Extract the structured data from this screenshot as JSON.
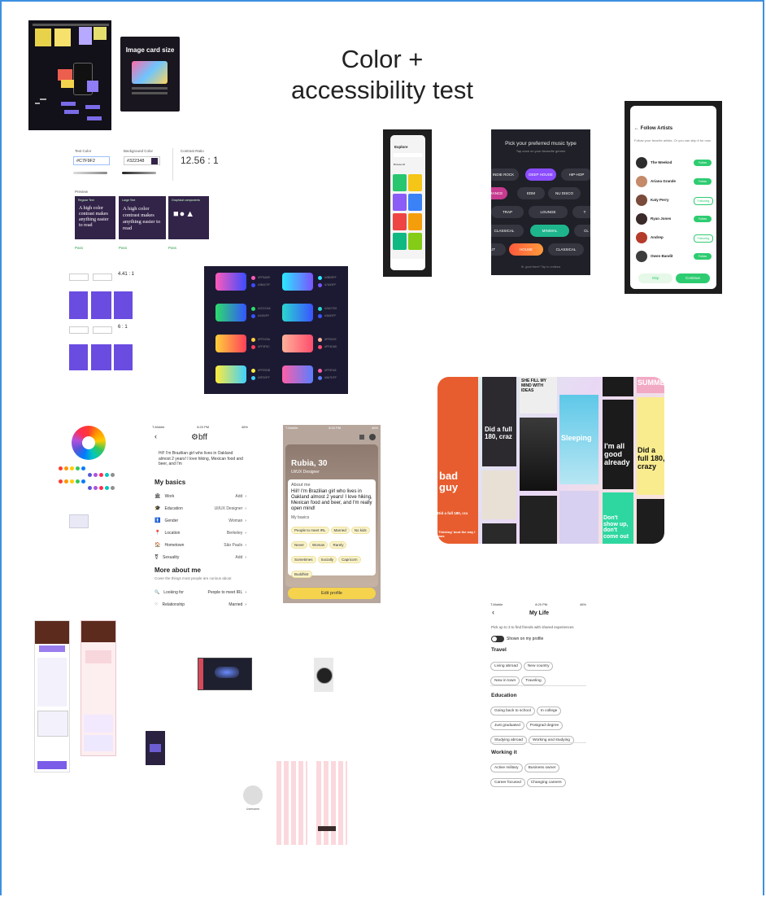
{
  "canvas": {
    "title_line1": "Color +",
    "title_line2": "accessibility test"
  },
  "image_card": {
    "title": "Image card size"
  },
  "contrast_test": {
    "text_color_label": "Text Color",
    "bg_color_label": "Background Color",
    "ratio_label": "Contrast Ratio",
    "text_color": "#C7F9F2",
    "bg_color": "#322348",
    "ratio": "12.56 : 1",
    "preview_label": "Preview",
    "normal_text_label": "Regular Text",
    "large_text_label": "Large Text",
    "graphical_label": "Graphical components",
    "sample": "A high color contrast makes anything easier to read",
    "pass": "Pass"
  },
  "mini_contrast": {
    "ratio1": "4.41 : 1",
    "ratio2": "6 : 1"
  },
  "gradients": {
    "rows": [
      {
        "c1": "#ff5ab9",
        "c2": "#3b4cff",
        "h1": "#FF5AB9",
        "h2": "#3B4CFF"
      },
      {
        "c1": "#2be8ff",
        "c2": "#7a53ff",
        "h1": "#2BE8FF",
        "h2": "#7A53FF"
      },
      {
        "c1": "#2cdc6a",
        "c2": "#3454ff",
        "h1": "#2CDC6A",
        "h2": "#3454FF"
      },
      {
        "c1": "#2ad7d0",
        "c2": "#3a52ff",
        "h1": "#2AD7D0",
        "h2": "#3A52FF"
      },
      {
        "c1": "#ffd03a",
        "c2": "#ff3f5c",
        "h1": "#FFD03A",
        "h2": "#FF3F5C"
      },
      {
        "c1": "#ffb199",
        "c2": "#ff4d6d",
        "h1": "#FFB199",
        "h2": "#FF4D6D"
      },
      {
        "c1": "#ffeb3b",
        "c2": "#3fd0ff",
        "h1": "#FFEB3B",
        "h2": "#3FD0FF"
      },
      {
        "c1": "#ff5fa8",
        "c2": "#5a7dff",
        "h1": "#FF5FA8",
        "h2": "#5A7DFF"
      }
    ]
  },
  "explore": {
    "title": "Explore",
    "browse": "Browse All"
  },
  "music_type": {
    "title": "Pick your preferred music type",
    "subtitle": "Tap once on your favourite genres",
    "row1": [
      "INDIE ROCK",
      "DEEP HOUSE",
      "HIP-HOP"
    ],
    "row2": [
      "TRANCE",
      "EDM",
      "NU DISCO"
    ],
    "row3": [
      "TRAP",
      "LOUNGE",
      "T"
    ],
    "row4": [
      "CLASSICAL",
      "MINIMAL",
      "CL"
    ],
    "row5": [
      "UT",
      "HOUSE",
      "CLASSICAL"
    ],
    "footer": "Hi, good there? Tap to continue"
  },
  "follow_artists": {
    "title": "Follow Artists",
    "subtitle": "Follow your favorite artists. Or you can skip it for now.",
    "artists": [
      {
        "name": "The Weeknd",
        "action": "Follow"
      },
      {
        "name": "Ariana Grande",
        "action": "Follow"
      },
      {
        "name": "Katy Perry",
        "action": "Following"
      },
      {
        "name": "Ryan Jones",
        "action": "Follow"
      },
      {
        "name": "Andrep",
        "action": "Following"
      },
      {
        "name": "Owen Bandit",
        "action": "Follow"
      }
    ],
    "skip": "Skip",
    "continue": "Continue"
  },
  "music_collage": {
    "bad_guy": "bad guy",
    "did_a_full_1": "Did a full 180, craz",
    "sleeping": "Sleeping",
    "im_all_good": "I'm all good already",
    "did_a_full_2": "Did a full 180, crazy",
    "dont_show": "Don't show up, don't come out",
    "ideas": "SHE FILL MY MIND WITH IDEAS",
    "summer": "SUMME",
    "thinking": "Thinking' bout the way I was",
    "did_small": "Did a full 180, cra"
  },
  "bff_profile": {
    "status_carrier": "T-Mobile",
    "status_time": "8:20 PM",
    "status_battery": "46%",
    "brand": "bff",
    "intro": "Hi!! I'm Brazilian girl who lives in Oakland almost 2 years! I love hiking, Mexican food and beer, and I'm",
    "basics_title": "My basics",
    "basics": [
      {
        "label": "Work",
        "value": "Add"
      },
      {
        "label": "Education",
        "value": "UI/UX Designer"
      },
      {
        "label": "Gender",
        "value": "Woman"
      },
      {
        "label": "Location",
        "value": "Berkeley"
      },
      {
        "label": "Hometown",
        "value": "São Paulo"
      },
      {
        "label": "Sexuality",
        "value": "Add"
      }
    ],
    "more_title": "More about me",
    "more_subtitle": "Cover the things most people are curious about",
    "more": [
      {
        "label": "Looking for",
        "value": "People to meet IRL"
      },
      {
        "label": "Relationship",
        "value": "Married"
      }
    ]
  },
  "rubia_card": {
    "status_carrier": "T-Mobile",
    "status_time": "8:20 PM",
    "status_battery": "46%",
    "name": "Rubia, 30",
    "role": "UI/UX Designer",
    "about_title": "About me",
    "about": "Hii!! I'm Brazilian girl who lives in Oakland almost 2 years! I love hiking, Mexican food and beer, and I'm really open mind!",
    "basics_title": "My basics",
    "chips": [
      "People to meet IRL",
      "Married",
      "No kids",
      "Never",
      "Woman",
      "Rarely",
      "Sometimes",
      "Socially",
      "Capricorn",
      "Buddhist"
    ],
    "edit": "Edit profile"
  },
  "my_life": {
    "status_carrier": "T-Mobile",
    "status_time": "8:20 PM",
    "status_battery": "46%",
    "title": "My Life",
    "subtitle": "Pick up to 3 to find friends with shared experiences",
    "toggle_label": "Shown on my profile",
    "travel_title": "Travel",
    "travel": [
      "Living abroad",
      "New country",
      "New in town",
      "Traveling"
    ],
    "education_title": "Education",
    "education": [
      "Going back to school",
      "In college",
      "Just graduated",
      "Postgrad degree",
      "Studying abroad",
      "Working and studying"
    ],
    "working_title": "Working it",
    "working": [
      "Active military",
      "Business owner",
      "Career focused",
      "Changing careers"
    ]
  },
  "misc": {
    "avatar_caption": "Username"
  }
}
